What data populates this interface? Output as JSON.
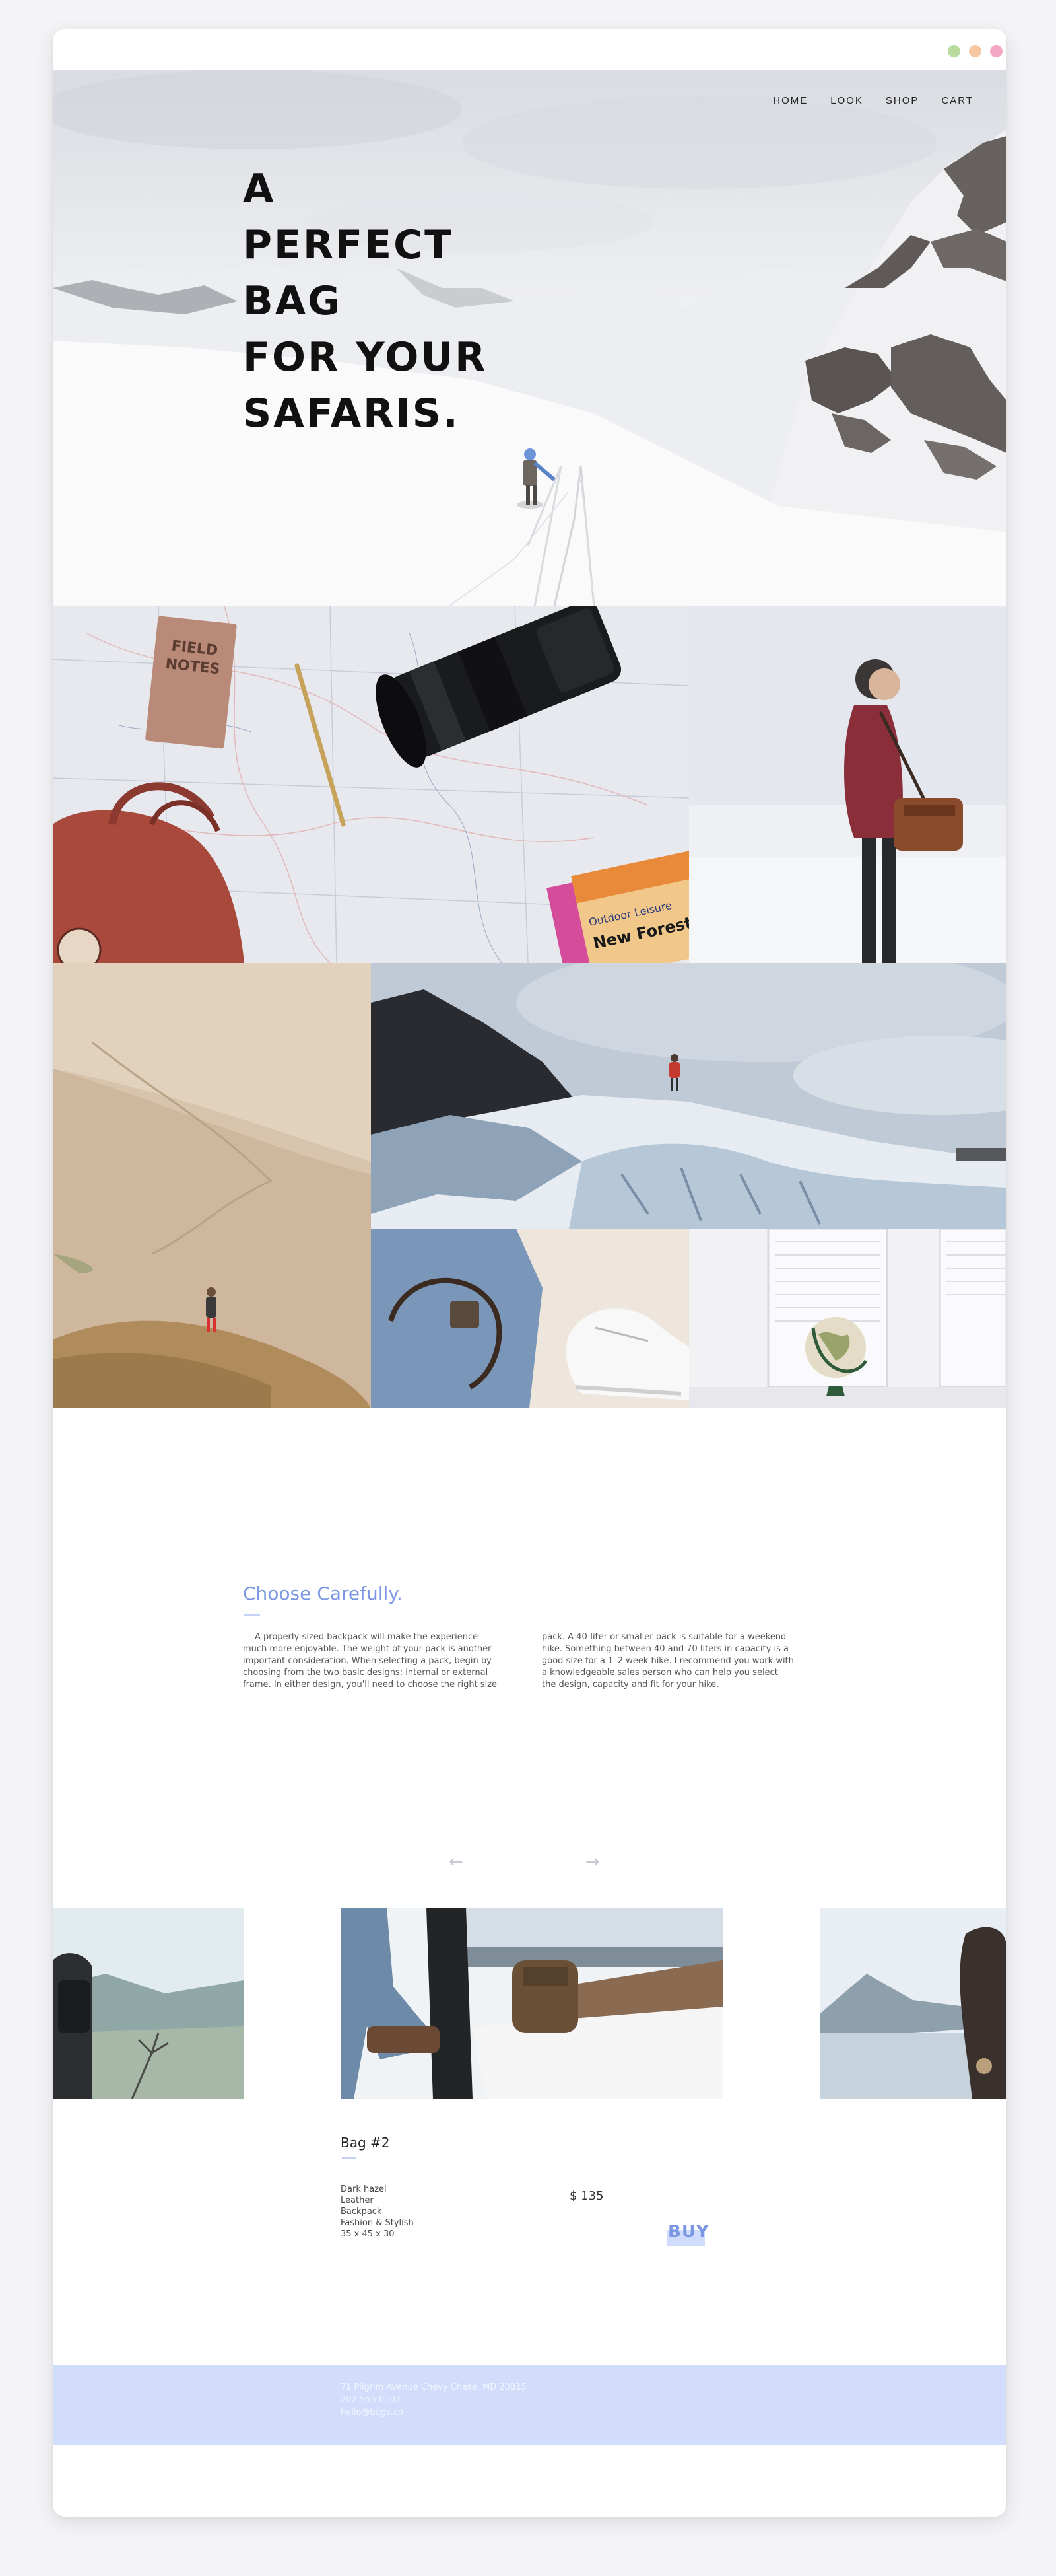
{
  "nav": {
    "home": "HOME",
    "look": "LOOK",
    "shop": "SHOP",
    "cart": "CART"
  },
  "window_controls": {
    "green": "#b9dc9e",
    "orange": "#f6c7a1",
    "pink": "#f3a7c3"
  },
  "hero": {
    "headline_lines": [
      "A",
      "PERFECT",
      "BAG",
      "FOR YOUR",
      "SAFARIS."
    ]
  },
  "gallery": {
    "notebook_cover": [
      "FIELD",
      "NOTES"
    ],
    "map_cover": [
      "Outdoor Leisure",
      "New Forest"
    ]
  },
  "choose": {
    "title": "Choose Carefully.",
    "col1": [
      "A properly-sized backpack will make the experience",
      "much more enjoyable. The weight of your pack is another",
      "important consideration. When selecting a pack, begin by",
      "choosing from the two basic designs: internal or external",
      "frame. In either design, you'll need to choose the right size"
    ],
    "col2": [
      "pack. A 40-liter or smaller pack is suitable for a weekend",
      "hike. Something between 40 and 70 liters in capacity is a",
      "good size for a 1–2 week hike. I recommend you work with",
      "a knowledgeable sales person who can help you select",
      "the design, capacity and fit for your hike."
    ]
  },
  "carousel": {
    "prev": "←",
    "next": "→",
    "product": {
      "name": "Bag #2",
      "specs": [
        "Dark hazel",
        "Leather",
        "Backpack",
        "Fashion & Stylish",
        "35 x 45 x 30"
      ],
      "price": "$ 135",
      "buy": "BUY"
    }
  },
  "footer": {
    "address": "71 Pilgrim Avenue Chevy Chase, MD 20815",
    "phone": "202 555 0102",
    "email": "hello@bags.co"
  },
  "colors": {
    "accent": "#7b97e2",
    "footer_bg": "#d1ddfb",
    "buy_bg": "#cfdcfb"
  }
}
